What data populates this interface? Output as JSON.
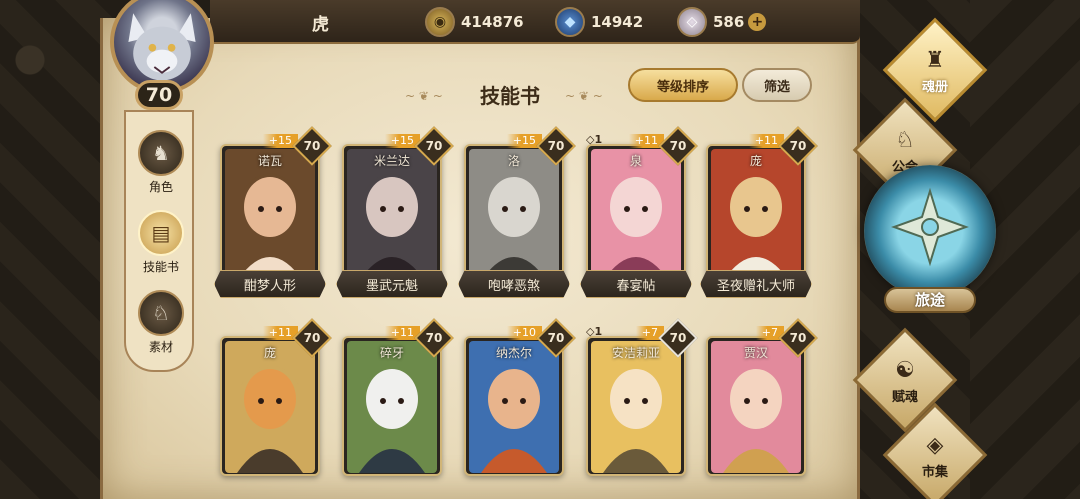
{
  "header": {
    "player_name": "虎",
    "level": "70",
    "currencies": {
      "gold": "414876",
      "crystal": "14942",
      "gem": "586"
    },
    "plus_symbol": "+"
  },
  "left_nav": [
    {
      "label": "角色",
      "icon": "helmet-icon",
      "active": false
    },
    {
      "label": "技能书",
      "icon": "skill-book-icon",
      "active": true
    },
    {
      "label": "素材",
      "icon": "beast-head-icon",
      "active": false
    }
  ],
  "page": {
    "title": "技能书",
    "sort_label": "等级排序",
    "filter_label": "筛选"
  },
  "cards": [
    {
      "top_name": "诺瓦",
      "name": "酣梦人形",
      "bonus": "+15",
      "level": "70",
      "rank": "",
      "palette": [
        "#6b4a2c",
        "#e6b894",
        "#f2ddc8"
      ]
    },
    {
      "top_name": "米兰达",
      "name": "墨武元魁",
      "bonus": "+15",
      "level": "70",
      "rank": "",
      "palette": [
        "#4a4448",
        "#d8c6c0",
        "#2a2226"
      ]
    },
    {
      "top_name": "洛",
      "name": "咆哮恶煞",
      "bonus": "+15",
      "level": "70",
      "rank": "",
      "palette": [
        "#8e8c86",
        "#d9d6cf",
        "#3c3a36"
      ]
    },
    {
      "top_name": "泉",
      "name": "春宴帖",
      "bonus": "+11",
      "level": "70",
      "rank": "◇1",
      "palette": [
        "#e892a6",
        "#f4d6d4",
        "#8a3c58"
      ]
    },
    {
      "top_name": "庞",
      "name": "圣夜赠礼大师",
      "bonus": "+11",
      "level": "70",
      "rank": "",
      "palette": [
        "#b6462c",
        "#e8c68e",
        "#f2ecde"
      ]
    },
    {
      "top_name": "庞",
      "name": "",
      "bonus": "+11",
      "level": "70",
      "rank": "",
      "palette": [
        "#cfa95c",
        "#e49a4c",
        "#4a3c2c"
      ]
    },
    {
      "top_name": "碎牙",
      "name": "",
      "bonus": "+11",
      "level": "70",
      "rank": "",
      "palette": [
        "#6c8a4a",
        "#f0f0ee",
        "#2e3a44"
      ]
    },
    {
      "top_name": "纳杰尔",
      "name": "",
      "bonus": "+10",
      "level": "70",
      "rank": "",
      "palette": [
        "#3e6fb0",
        "#e8b48c",
        "#c65a2c"
      ]
    },
    {
      "top_name": "安洁莉亚",
      "name": "",
      "bonus": "+7",
      "level": "70",
      "rank": "◇1",
      "palette": [
        "#e8c060",
        "#f6e2c4",
        "#6a5a3a"
      ]
    },
    {
      "top_name": "贾汉",
      "name": "",
      "bonus": "+7",
      "level": "70",
      "rank": "",
      "palette": [
        "#e28a9c",
        "#f4d4c0",
        "#d0a050"
      ]
    }
  ],
  "right_nav": {
    "soul_label": "魂册",
    "guild_label": "公会",
    "journey_label": "旅途",
    "talent_label": "赋魂",
    "market_label": "市集"
  }
}
